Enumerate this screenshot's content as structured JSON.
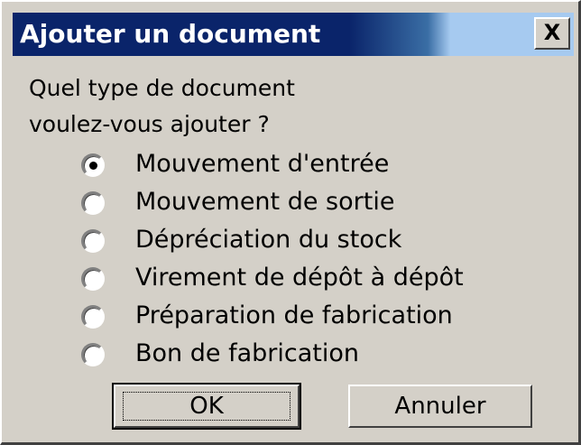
{
  "dialog": {
    "title": "Ajouter un document",
    "close_label": "X",
    "question_line1": "Quel type de document",
    "question_line2": "voulez-vous ajouter ?"
  },
  "options": [
    {
      "label": "Mouvement d'entrée",
      "selected": true
    },
    {
      "label": "Mouvement de sortie",
      "selected": false
    },
    {
      "label": "Dépréciation du stock",
      "selected": false
    },
    {
      "label": "Virement de dépôt à dépôt",
      "selected": false
    },
    {
      "label": "Préparation de fabrication",
      "selected": false
    },
    {
      "label": "Bon de fabrication",
      "selected": false
    }
  ],
  "buttons": {
    "ok_label": "OK",
    "cancel_label": "Annuler"
  }
}
